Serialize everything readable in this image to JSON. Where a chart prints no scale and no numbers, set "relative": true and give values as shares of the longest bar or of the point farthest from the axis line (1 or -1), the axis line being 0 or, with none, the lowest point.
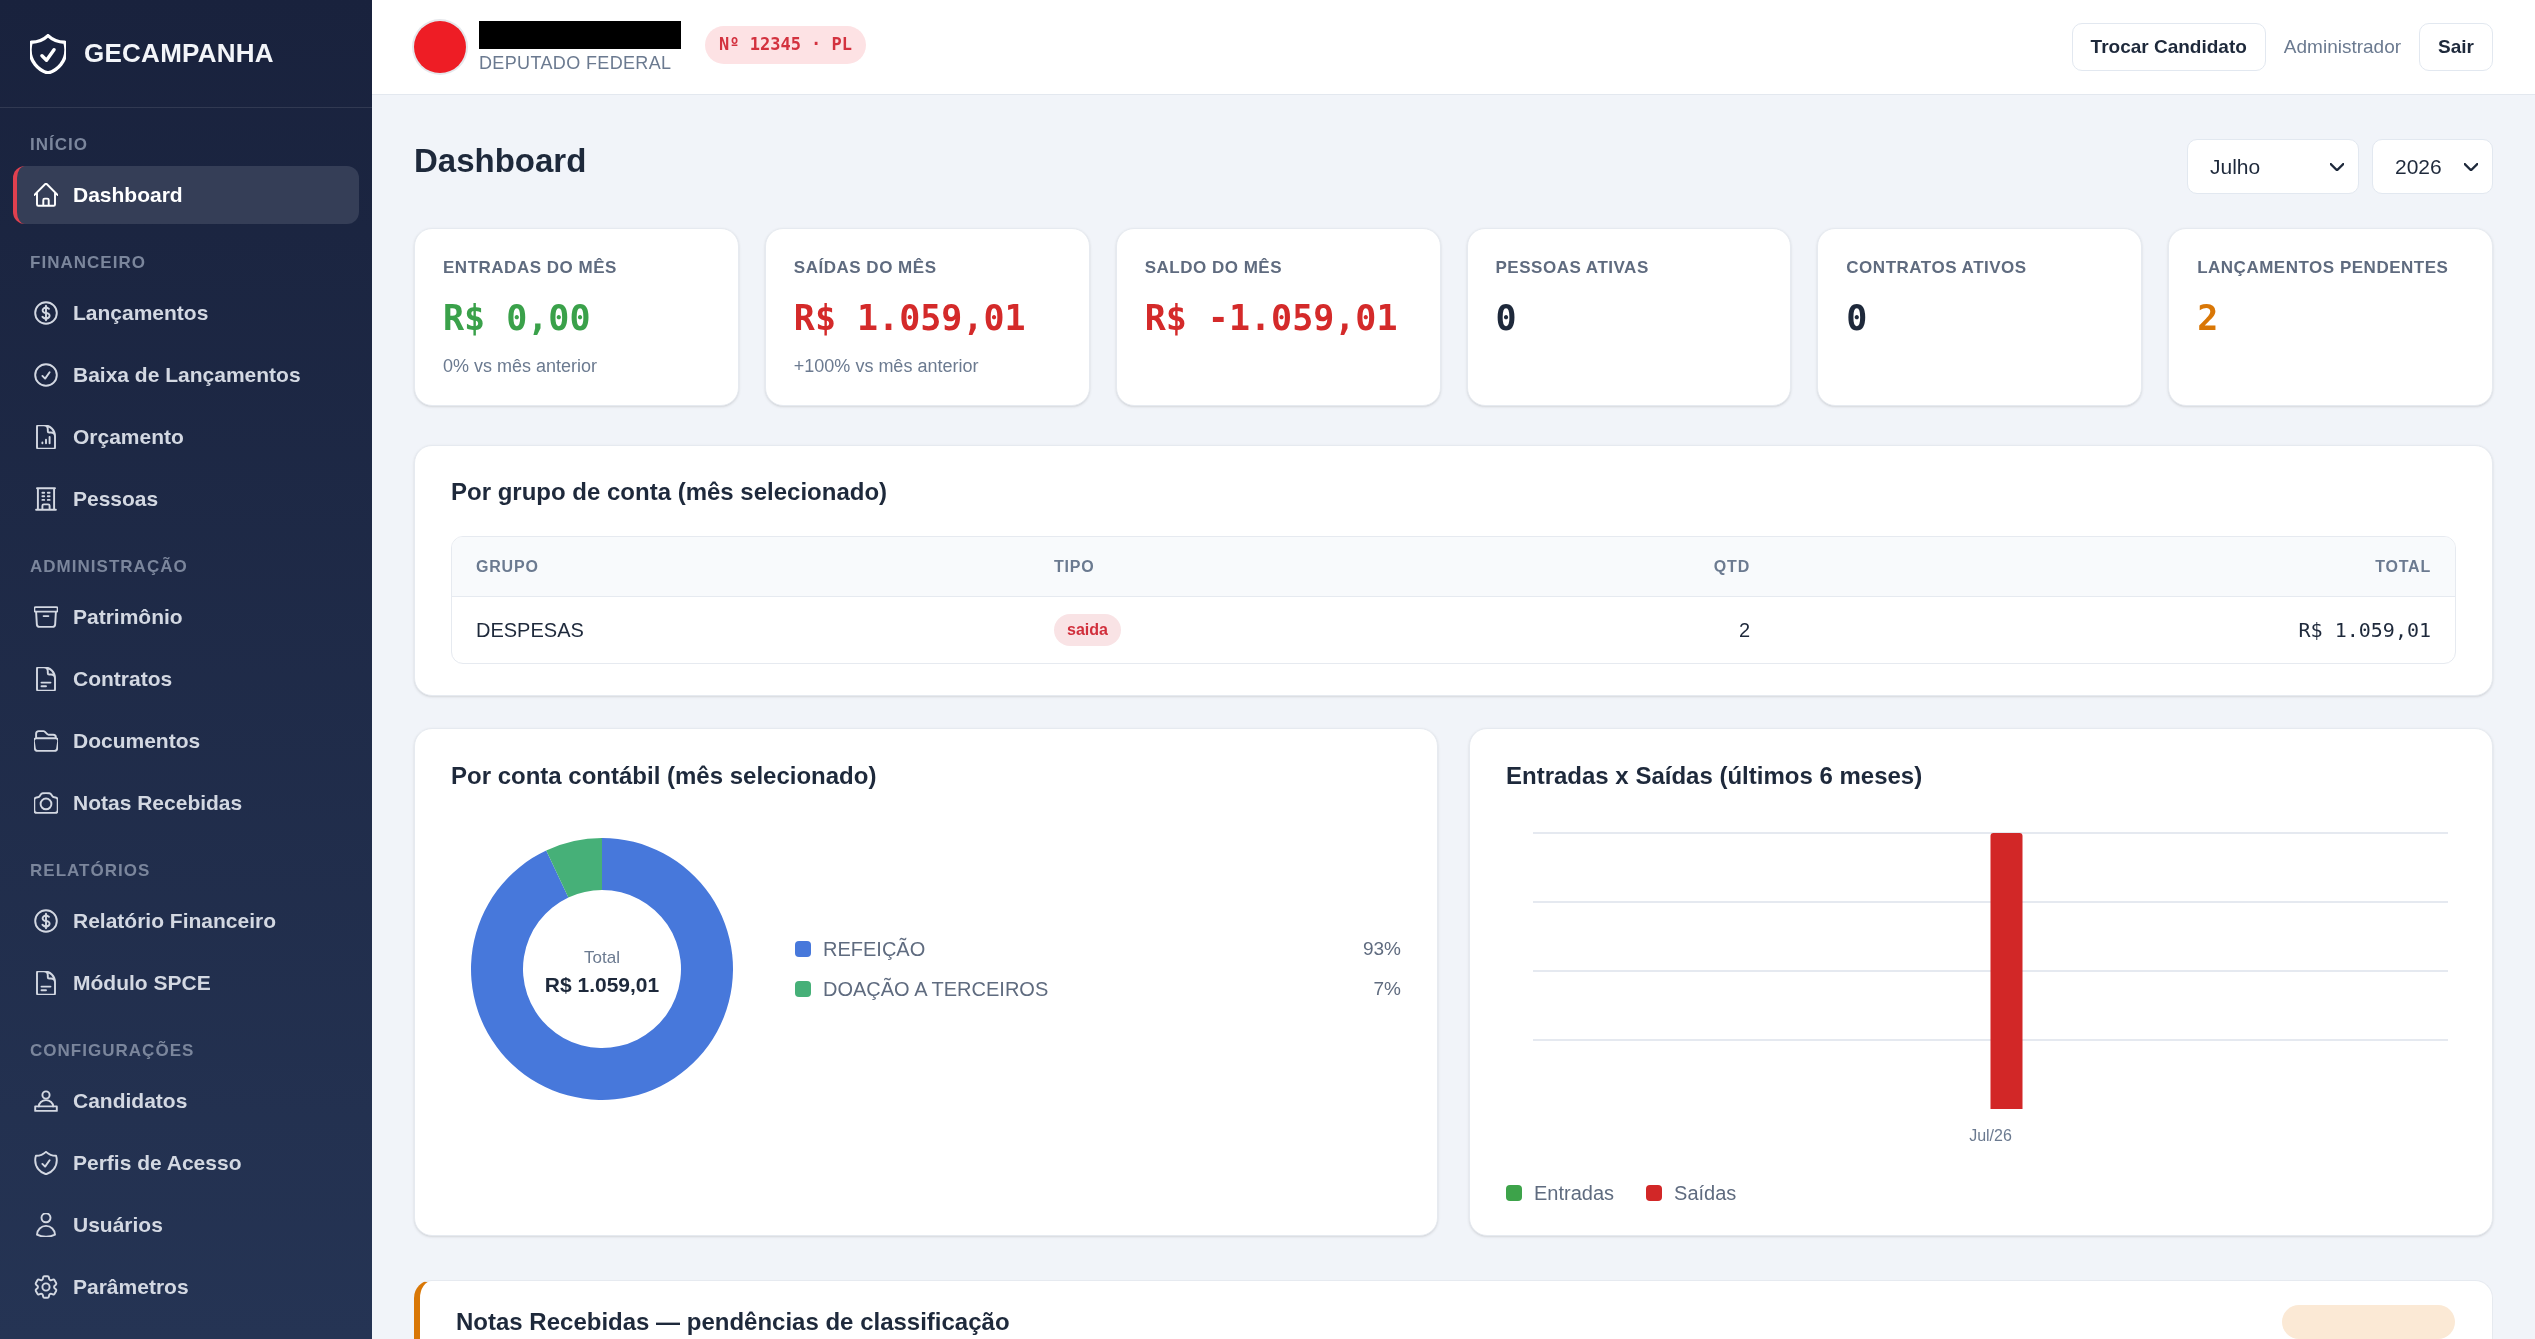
{
  "sidebar": {
    "brand": "GECAMPANHA",
    "sections": [
      {
        "title": "INÍCIO",
        "items": [
          {
            "label": "Dashboard",
            "selected": true
          }
        ]
      },
      {
        "title": "FINANCEIRO",
        "items": [
          {
            "label": "Lançamentos",
            "selected": false
          },
          {
            "label": "Baixa de Lançamentos",
            "selected": false
          },
          {
            "label": "Orçamento",
            "selected": false
          },
          {
            "label": "Pessoas",
            "selected": false
          }
        ]
      },
      {
        "title": "ADMINISTRAÇÃO",
        "items": [
          {
            "label": "Patrimônio",
            "selected": false
          },
          {
            "label": "Contratos",
            "selected": false
          },
          {
            "label": "Documentos",
            "selected": false
          },
          {
            "label": "Notas Recebidas",
            "selected": false
          }
        ]
      },
      {
        "title": "RELATÓRIOS",
        "items": [
          {
            "label": "Relatório Financeiro",
            "selected": false
          },
          {
            "label": "Módulo SPCE",
            "selected": false
          }
        ]
      },
      {
        "title": "CONFIGURAÇÕES",
        "items": [
          {
            "label": "Candidatos",
            "selected": false
          },
          {
            "label": "Perfis de Acesso",
            "selected": false
          },
          {
            "label": "Usuários",
            "selected": false
          },
          {
            "label": "Parâmetros",
            "selected": false
          }
        ]
      }
    ]
  },
  "header": {
    "candidate_office": "DEPUTADO FEDERAL",
    "number_badge": "Nº 12345 · PL",
    "switch_button": "Trocar Candidato",
    "user_name": "Administrador",
    "logout_button": "Sair"
  },
  "page": {
    "title": "Dashboard",
    "filters": [
      {
        "value": "Julho"
      },
      {
        "value": "2026"
      }
    ]
  },
  "stats": [
    {
      "label": "ENTRADAS DO MÊS",
      "value": "R$ 0,00",
      "color": "#3aa14a",
      "note": "0% vs mês anterior"
    },
    {
      "label": "SAÍDAS DO MÊS",
      "value": "R$ 1.059,01",
      "color": "#d42a2a",
      "note": "+100% vs mês anterior"
    },
    {
      "label": "SALDO DO MÊS",
      "value": "R$ -1.059,01",
      "color": "#d42a2a"
    },
    {
      "label": "PESSOAS ATIVAS",
      "value": "0",
      "color": "#1e293b"
    },
    {
      "label": "CONTRATOS ATIVOS",
      "value": "0",
      "color": "#1e293b"
    },
    {
      "label": "LANÇAMENTOS PENDENTES",
      "value": "2",
      "color": "#d97706"
    }
  ],
  "group_table": {
    "title": "Por grupo de conta (mês selecionado)",
    "columns": [
      "GRUPO",
      "TIPO",
      "QTD",
      "TOTAL"
    ],
    "rows": [
      {
        "group": "DESPESAS",
        "type": {
          "label": "saida",
          "color": "#d12f3c"
        },
        "qty": "2",
        "total": "R$ 1.059,01"
      }
    ]
  },
  "account_chart": {
    "title": "Por conta contábil (mês selecionado)",
    "center_label": "Total",
    "center_value": "R$ 1.059,01",
    "chart_data": {
      "type": "donut",
      "categories": [
        "REFEIÇÃO",
        "DOAÇÃO A TERCEIROS"
      ],
      "values": [
        93,
        7
      ],
      "legend": "right"
    },
    "legend": [
      {
        "share": "93%",
        "color": "#4778db"
      },
      {
        "share": "7%",
        "color": "#46b078"
      }
    ]
  },
  "trend_chart": {
    "title": "Entradas x Saídas (últimos 6 meses)",
    "chart_data": {
      "type": "bar",
      "categories": [
        "Jul/26"
      ],
      "series": [
        {
          "name": "Entradas",
          "color": "#3da34a",
          "values": [
            0
          ]
        },
        {
          "name": "Saídas",
          "color": "#d22727",
          "values": [
            1
          ]
        }
      ],
      "relative": true,
      "legend": "bottom"
    }
  },
  "notes_panel": {
    "title": "Notas Recebidas — pendências de classificação"
  }
}
